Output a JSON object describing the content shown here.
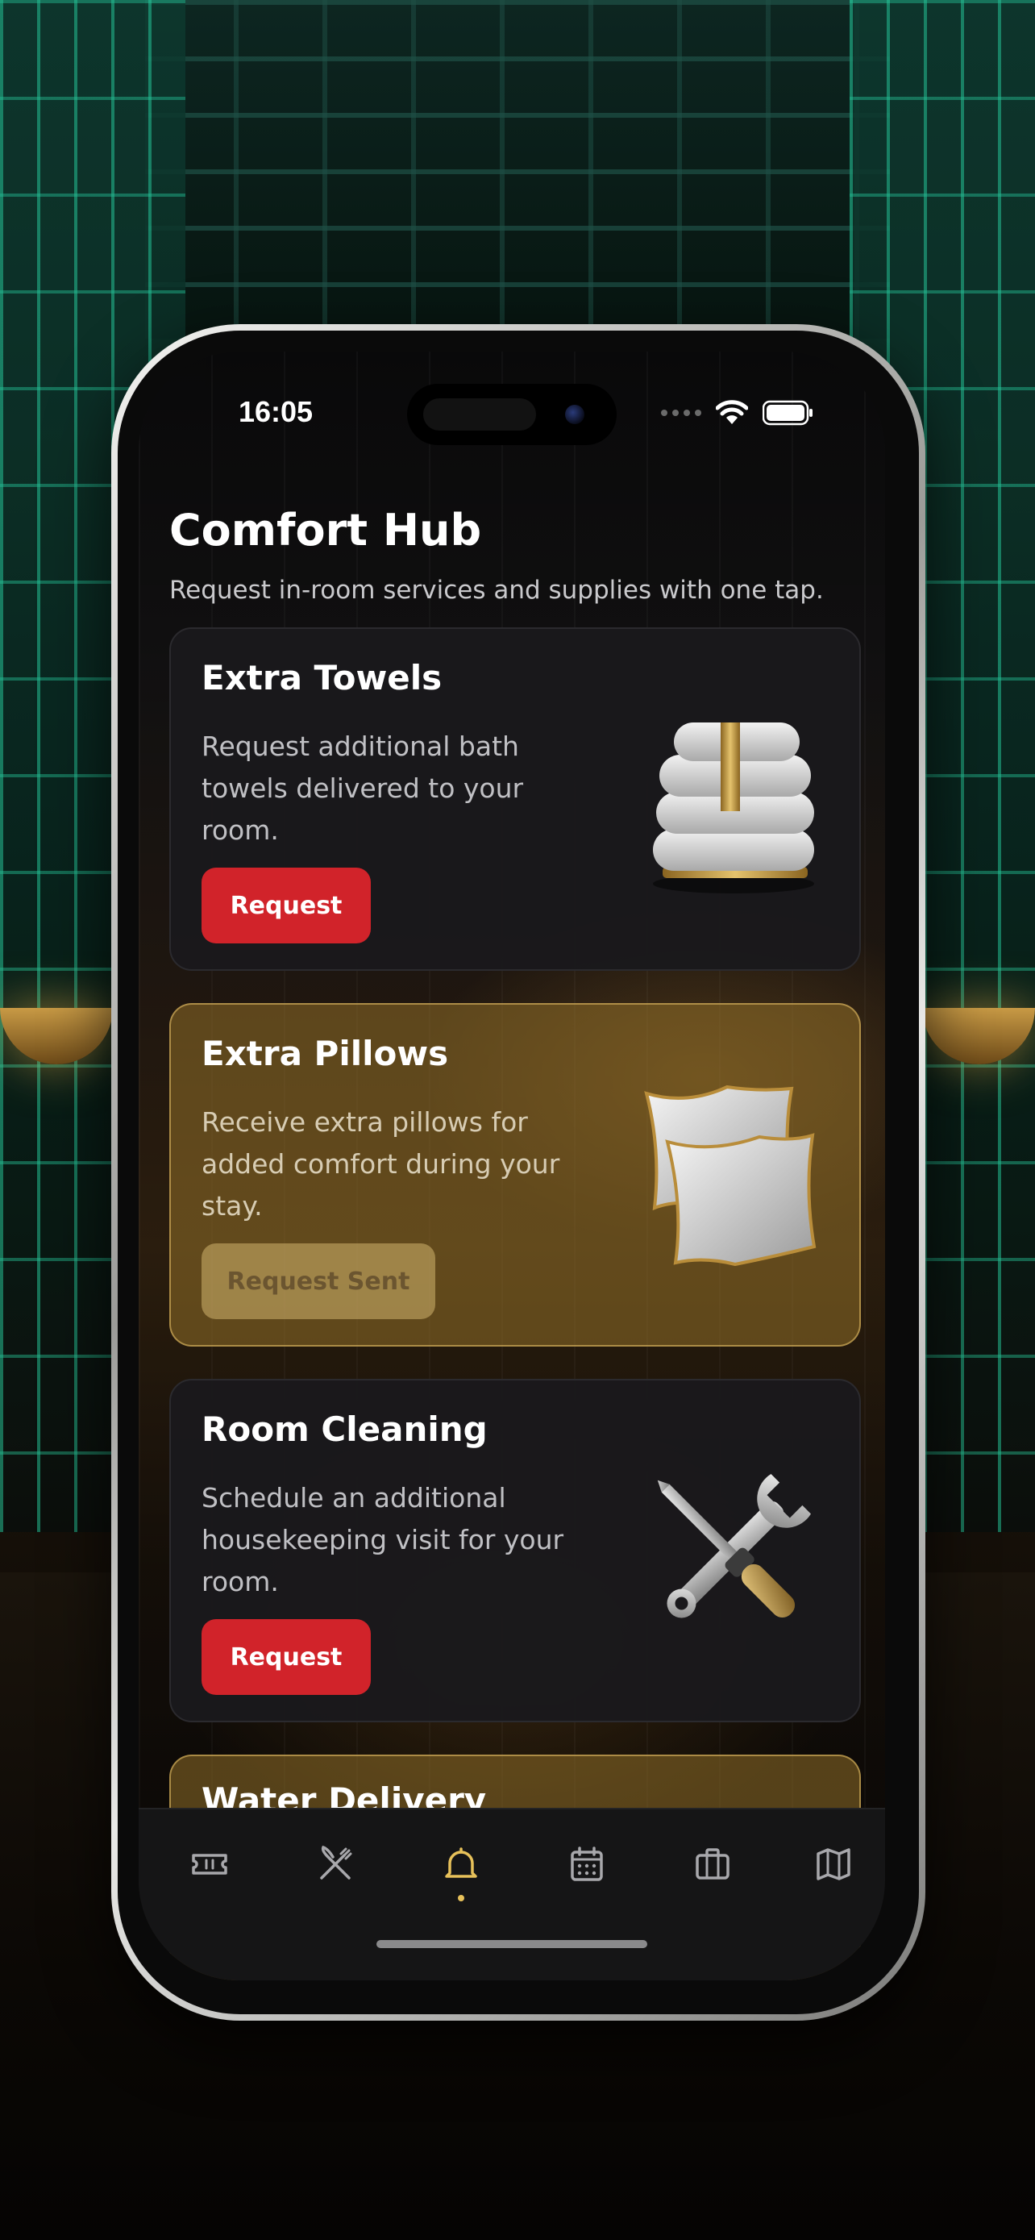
{
  "status_bar": {
    "time": "16:05",
    "icons": [
      "signal-dots",
      "wifi-icon",
      "battery-icon"
    ]
  },
  "header": {
    "title": "Comfort Hub",
    "subtitle": "Request in-room services and supplies with one tap."
  },
  "services": [
    {
      "title": "Extra Towels",
      "description": "Request additional bath towels delivered to your room.",
      "button_label": "Request",
      "state": "available",
      "icon": "towels-icon"
    },
    {
      "title": "Extra Pillows",
      "description": "Receive extra pillows for added comfort during your stay.",
      "button_label": "Request Sent",
      "state": "sent",
      "icon": "pillows-icon"
    },
    {
      "title": "Room Cleaning",
      "description": "Schedule an additional housekeeping visit for your room.",
      "button_label": "Request",
      "state": "available",
      "icon": "wrench-screwdriver-icon"
    },
    {
      "title": "Water Delivery",
      "state": "sent"
    }
  ],
  "tab_bar": {
    "items": [
      {
        "icon": "ticket-icon",
        "active": false
      },
      {
        "icon": "dining-icon",
        "active": false
      },
      {
        "icon": "bell-icon",
        "active": true
      },
      {
        "icon": "calendar-icon",
        "active": false
      },
      {
        "icon": "briefcase-icon",
        "active": false
      },
      {
        "icon": "map-icon",
        "active": false
      }
    ]
  },
  "colors": {
    "accent_red": "#d1232a",
    "accent_gold": "#e7c15a",
    "card_dark": "#1a191c",
    "card_gold": "#917028"
  }
}
